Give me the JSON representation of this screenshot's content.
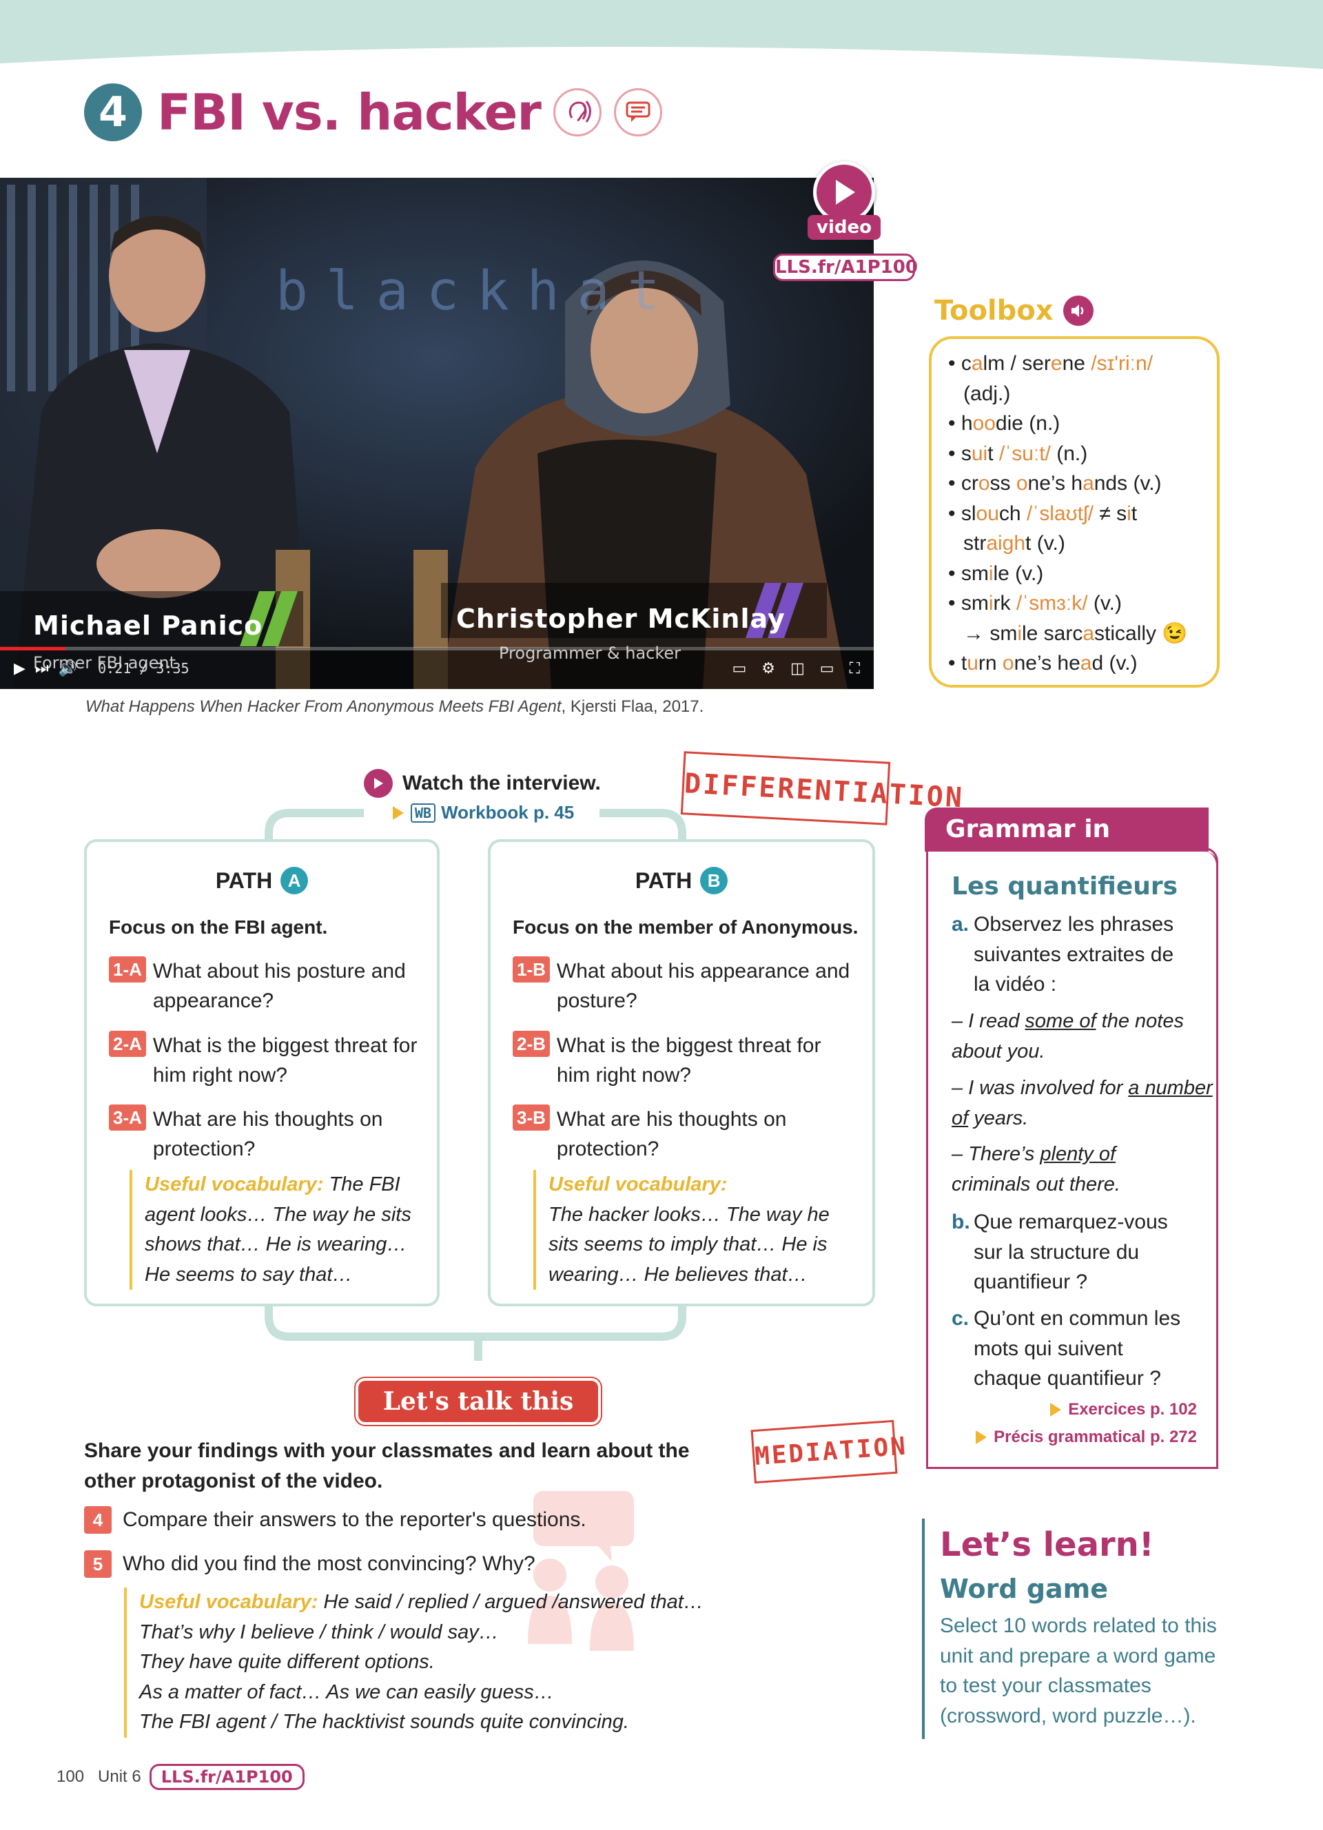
{
  "header": {
    "number": "4",
    "title": "FBI vs. hacker",
    "icons": [
      "listening-icon",
      "speaking-icon"
    ]
  },
  "video": {
    "overlay_word": "blackhat",
    "person1_name": "Michael Panico",
    "person1_role": "Former FBI agent",
    "person2_name": "Christopher McKinlay",
    "person2_role": "Programmer & hacker",
    "time": "0:21 / 3:35",
    "progress": 0.075,
    "badge_label": "video",
    "link": "LLS.fr/A1P100"
  },
  "caption": {
    "title": "What Happens When Hacker From Anonymous Meets FBI Agent",
    "credit": ", Kjersti Flaa, 2017."
  },
  "toolbox": {
    "title": "Toolbox",
    "lines": [
      {
        "html": "• c<span class='or'>a</span>lm / ser<span class='or'>e</span>ne <span class='or'>/sɪ'riːn/</span>",
        "indent": false
      },
      {
        "html": "(adj.)",
        "indent": true
      },
      {
        "html": "• h<span class='or'>oo</span>die (n.)",
        "indent": false
      },
      {
        "html": "• s<span class='or'>ui</span>t <span class='or'>/ˈsuːt/</span> (n.)",
        "indent": false
      },
      {
        "html": "• cr<span class='or'>o</span>ss <span class='or'>o</span>ne’s h<span class='or'>a</span>nds (v.)",
        "indent": false
      },
      {
        "html": "• sl<span class='or'>ou</span>ch <span class='or'>/ˈslaʊtʃ/</span> ≠ s<span class='or'>i</span>t",
        "indent": false
      },
      {
        "html": "str<span class='or'>aigh</span>t (v.)",
        "indent": true
      },
      {
        "html": "• sm<span class='or'>i</span>le (v.)",
        "indent": false
      },
      {
        "html": "• sm<span class='or'>i</span>rk <span class='or'>/ˈsmɜːk/</span> (v.)",
        "indent": false
      },
      {
        "html": "→ sm<span class='or'>i</span>le sarc<span class='or'>a</span>stically 😉",
        "indent": true
      },
      {
        "html": "• t<span class='or'>u</span>rn <span class='or'>o</span>ne’s he<span class='or'>a</span>d (v.)",
        "indent": false
      }
    ]
  },
  "watch": {
    "label": "Watch the interview.",
    "workbook_icon": "WB",
    "workbook": "Workbook p. 45"
  },
  "stamps": {
    "differentiation": "DIFFERENTIATION",
    "mediation": "MEDIATION"
  },
  "path_a": {
    "label": "PATH",
    "letter": "A",
    "focus": "Focus on the FBI agent.",
    "questions": [
      {
        "tag": "1-A",
        "text": "What about his posture and appearance?"
      },
      {
        "tag": "2-A",
        "text": "What is the biggest threat for him right now?"
      },
      {
        "tag": "3-A",
        "text": "What are his thoughts on protection?"
      }
    ],
    "vocab_label": "Useful vocabulary:",
    "vocab_text": " The FBI agent looks… The way he sits shows that… He is wearing… He seems to say that…"
  },
  "path_b": {
    "label": "PATH",
    "letter": "B",
    "focus": "Focus on the member of Anonymous.",
    "questions": [
      {
        "tag": "1-B",
        "text": "What about his appearance and posture?"
      },
      {
        "tag": "2-B",
        "text": "What is the biggest threat for him right now?"
      },
      {
        "tag": "3-B",
        "text": "What are his thoughts on protection?"
      }
    ],
    "vocab_label": "Useful vocabulary:",
    "vocab_text": "The hacker looks… The way he sits seems to imply that… He is wearing… He believes that…"
  },
  "grammar": {
    "header": "Grammar in progress",
    "title": "Les quantifieurs",
    "a_letter": "a.",
    "a_text": "Observez les phrases suivantes extraites de la vidéo :",
    "ex1_pre": "– I read ",
    "ex1_u": "some of",
    "ex1_post": " the notes about you.",
    "ex2_pre": "– I was involved for ",
    "ex2_u": "a number of",
    "ex2_post": " years.",
    "ex3_pre": "– There’s ",
    "ex3_u": "plenty of",
    "ex3_post": " criminals out there.",
    "b_letter": "b.",
    "b_text": "Que remarquez-vous sur la structure du quantifieur ?",
    "c_letter": "c.",
    "c_text": "Qu’ont en commun les mots qui suivent chaque quantifieur ?",
    "ref1": "Exercices p. 102",
    "ref2": "Précis grammatical p. 272"
  },
  "talk": {
    "button": "Let's talk this out!",
    "share": "Share your findings with your classmates and learn about the other protagonist of the video.",
    "q4_num": "4",
    "q4": "Compare their answers to the reporter's questions.",
    "q5_num": "5",
    "q5": "Who did you find the most convincing? Why?",
    "vocab_label": "Useful vocabulary:",
    "vocab_lines": [
      " He said / replied / argued /answered that…",
      "That’s why I believe / think / would say…",
      "They have quite different options.",
      "As a matter of fact… As we can easily guess…",
      "The FBI agent / The hacktivist sounds quite convincing."
    ]
  },
  "learn": {
    "title": "Let’s learn!",
    "subtitle": "Word game",
    "text": "Select 10 words related to this unit and prepare a word game to test your classmates (crossword, word puzzle…)."
  },
  "footer": {
    "page": "100",
    "unit": "Unit 6",
    "link": "LLS.fr/A1P100"
  },
  "colors": {
    "brand": "#b2356f",
    "teal": "#3e7d8c",
    "yellow": "#f0c340",
    "coral": "#e9685a"
  }
}
